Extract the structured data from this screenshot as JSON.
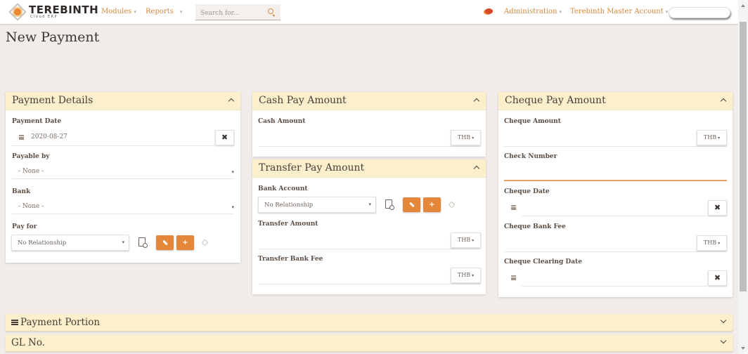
{
  "navbar": {
    "logo_title": "TEREBINTH",
    "logo_subtitle": "Cloud ERP",
    "modules_label": "Modules",
    "reports_label": "Reports",
    "search_placeholder": "Search for...",
    "administration_label": "Administration",
    "account_label": "Terebinth Master Account"
  },
  "page": {
    "title": "New Payment"
  },
  "payment_details": {
    "title": "Payment Details",
    "payment_date_label": "Payment Date",
    "payment_date_value": "2020-08-27",
    "payable_by_label": "Payable by",
    "payable_by_value": "- None -",
    "bank_label": "Bank",
    "bank_value": "- None -",
    "pay_for_label": "Pay for",
    "pay_for_value": "No Relationship"
  },
  "cash_pay": {
    "title": "Cash Pay Amount",
    "cash_amount_label": "Cash Amount",
    "currency": "THB"
  },
  "transfer_pay": {
    "title": "Transfer Pay Amount",
    "bank_account_label": "Bank Account",
    "bank_account_value": "No Relationship",
    "transfer_amount_label": "Transfer Amount",
    "transfer_amount_currency": "THB",
    "transfer_fee_label": "Transfer Bank Fee",
    "transfer_fee_currency": "THB"
  },
  "cheque_pay": {
    "title": "Cheque Pay Amount",
    "cheque_amount_label": "Cheque Amount",
    "cheque_amount_currency": "THB",
    "check_number_label": "Check Number",
    "cheque_date_label": "Cheque Date",
    "cheque_fee_label": "Cheque Bank Fee",
    "cheque_fee_currency": "THB",
    "clearing_date_label": "Cheque Clearing Date"
  },
  "sections": {
    "payment_portion": "Payment Portion",
    "gl_no": "GL No."
  },
  "glyphs": {
    "caret": "▾",
    "close": "✖",
    "plus": "+"
  },
  "colors": {
    "accent": "#e5873a",
    "panel_header": "#fbefcc",
    "background": "#f1ece9"
  }
}
